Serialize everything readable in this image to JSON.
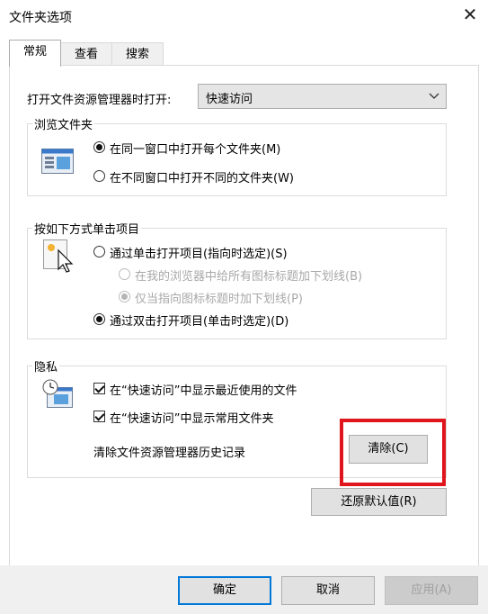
{
  "window": {
    "title": "文件夹选项",
    "close_glyph": "✕"
  },
  "tabs": [
    {
      "label": "常规",
      "active": true
    },
    {
      "label": "查看",
      "active": false
    },
    {
      "label": "搜索",
      "active": false
    }
  ],
  "open_explorer": {
    "label": "打开文件资源管理器时打开:",
    "selected": "快速访问"
  },
  "browse_folders": {
    "title": "浏览文件夹",
    "icon": "folder-window-icon",
    "options": [
      {
        "label": "在同一窗口中打开每个文件夹(M)",
        "checked": true
      },
      {
        "label": "在不同窗口中打开不同的文件夹(W)",
        "checked": false
      }
    ]
  },
  "click_items": {
    "title": "按如下方式单击项目",
    "icon": "cursor-click-icon",
    "single_click": {
      "label": "通过单击打开项目(指向时选定)(S)",
      "checked": false
    },
    "sub_options": [
      {
        "label": "在我的浏览器中给所有图标标题加下划线(B)",
        "checked": false,
        "disabled": true
      },
      {
        "label": "仅当指向图标标题时加下划线(P)",
        "checked": true,
        "disabled": true
      }
    ],
    "double_click": {
      "label": "通过双击打开项目(单击时选定)(D)",
      "checked": true
    }
  },
  "privacy": {
    "title": "隐私",
    "icon": "recent-files-icon",
    "checkboxes": [
      {
        "label": "在“快速访问”中显示最近使用的文件",
        "checked": true
      },
      {
        "label": "在“快速访问”中显示常用文件夹",
        "checked": true
      }
    ],
    "clear_history_label": "清除文件资源管理器历史记录",
    "clear_button": "清除(C)",
    "highlight_color": "#e0161c"
  },
  "restore_defaults": "还原默认值(R)",
  "footer": {
    "ok": "确定",
    "cancel": "取消",
    "apply": "应用(A)"
  },
  "colors": {
    "accent": "#0078d7",
    "dialog_bg": "#ffffff",
    "footer_bg": "#f0f0f0"
  }
}
